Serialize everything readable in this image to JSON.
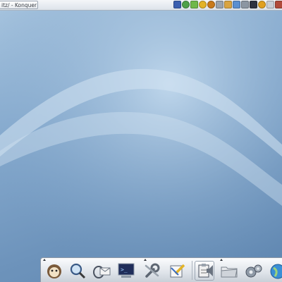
{
  "taskbar": {
    "window_title": "itz/ - Konquer"
  },
  "tray": {
    "icons": [
      "network-icon",
      "globe-icon",
      "antenna-icon",
      "speaker-icon",
      "gauge-icon",
      "mail-icon",
      "package-icon",
      "pen-icon",
      "printer-icon",
      "terminal-icon",
      "power-icon",
      "clipboard-icon",
      "extra-icon"
    ]
  },
  "panel": {
    "launchers": [
      "kde-menu-icon",
      "search-icon",
      "email-icon",
      "terminal-icon",
      "settings-icon",
      "edit-icon",
      "clipboard-icon",
      "sound-icon",
      "folder-icon",
      "gears-icon",
      "world-icon"
    ]
  },
  "colors": {
    "desktop_light": "#a9c6e0",
    "desktop_dark": "#5f86b0",
    "panel": "#dfe4ea"
  }
}
